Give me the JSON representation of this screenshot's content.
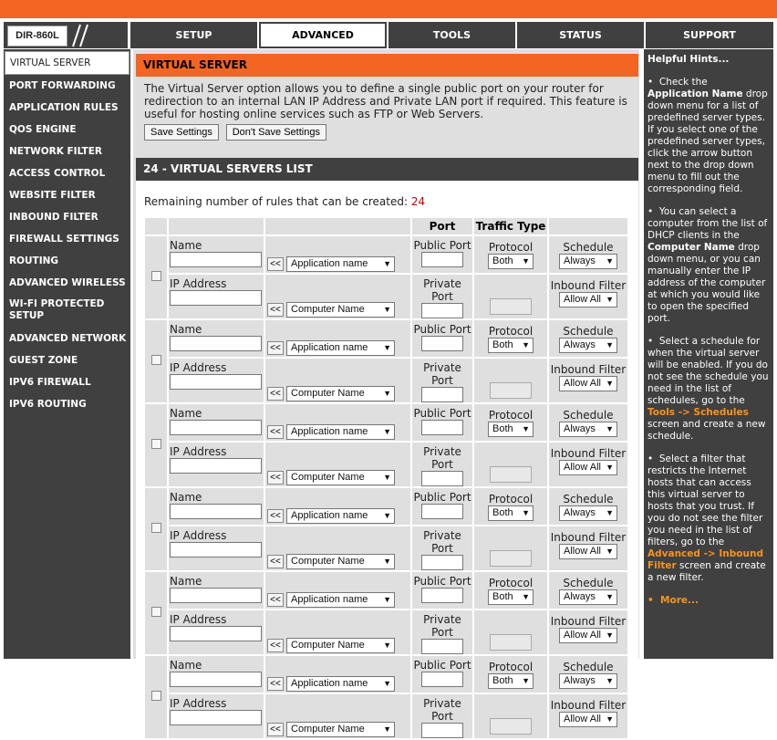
{
  "brand": {
    "model": "DIR-860L",
    "accent": "#f26522",
    "dark": "#404040"
  },
  "tabs": [
    {
      "label": "SETUP"
    },
    {
      "label": "ADVANCED"
    },
    {
      "label": "TOOLS"
    },
    {
      "label": "STATUS"
    },
    {
      "label": "SUPPORT"
    }
  ],
  "sidebar": [
    {
      "label": "VIRTUAL SERVER"
    },
    {
      "label": "PORT FORWARDING"
    },
    {
      "label": "APPLICATION RULES"
    },
    {
      "label": "QOS ENGINE"
    },
    {
      "label": "NETWORK FILTER"
    },
    {
      "label": "ACCESS CONTROL"
    },
    {
      "label": "WEBSITE FILTER"
    },
    {
      "label": "INBOUND FILTER"
    },
    {
      "label": "FIREWALL SETTINGS"
    },
    {
      "label": "ROUTING"
    },
    {
      "label": "ADVANCED WIRELESS"
    },
    {
      "label": "WI-FI PROTECTED SETUP"
    },
    {
      "label": "ADVANCED NETWORK"
    },
    {
      "label": "GUEST ZONE"
    },
    {
      "label": "IPV6 FIREWALL"
    },
    {
      "label": "IPV6 ROUTING"
    }
  ],
  "virtual_server": {
    "title": "VIRTUAL SERVER",
    "intro": "The Virtual Server option allows you to define a single public port on your router for redirection to an internal LAN IP Address and Private LAN port if required. This feature is useful for hosting online services such as FTP or Web Servers.",
    "save_label": "Save Settings",
    "dont_save_label": "Don't Save Settings"
  },
  "list": {
    "title": "24 - VIRTUAL SERVERS LIST",
    "remaining_text": "Remaining number of rules that can be created:",
    "remaining_count": "24",
    "header_port": "Port",
    "header_traffic": "Traffic Type",
    "labels": {
      "name": "Name",
      "ip": "IP Address",
      "public_port": "Public Port",
      "private_port": "Private Port",
      "protocol": "Protocol",
      "schedule": "Schedule",
      "inbound": "Inbound Filter",
      "arrow": "<<"
    },
    "values": {
      "app_name": "Application name",
      "computer_name": "Computer Name",
      "protocol": "Both",
      "schedule": "Always",
      "inbound": "Allow All"
    },
    "rows": [
      {
        "index": 1
      },
      {
        "index": 2
      },
      {
        "index": 3
      },
      {
        "index": 4
      },
      {
        "index": 5
      },
      {
        "index": 6
      }
    ]
  },
  "hints": {
    "title": "Helpful Hints...",
    "h1a": "Check the ",
    "h1b": "Application Name",
    "h1c": " drop down menu for a list of predefined server types. If you select one of the predefined server types, click the arrow button next to the drop down menu to fill out the corresponding field.",
    "h2a": "You can select a computer from the list of DHCP clients in the ",
    "h2b": "Computer Name",
    "h2c": " drop down menu, or you can manually enter the IP address of the computer at which you would like to open the specified port.",
    "h3a": "Select a schedule for when the virtual server will be enabled. If you do not see the schedule you need in the list of schedules, go to the ",
    "h3b": "Tools -> Schedules",
    "h3c": " screen and create a new schedule.",
    "h4a": "Select a filter that restricts the Internet hosts that can access this virtual server to hosts that you trust. If you do not see the filter you need in the list of filters, go to the ",
    "h4b": "Advanced -> Inbound Filter",
    "h4c": " screen and create a new filter.",
    "more": "More..."
  }
}
